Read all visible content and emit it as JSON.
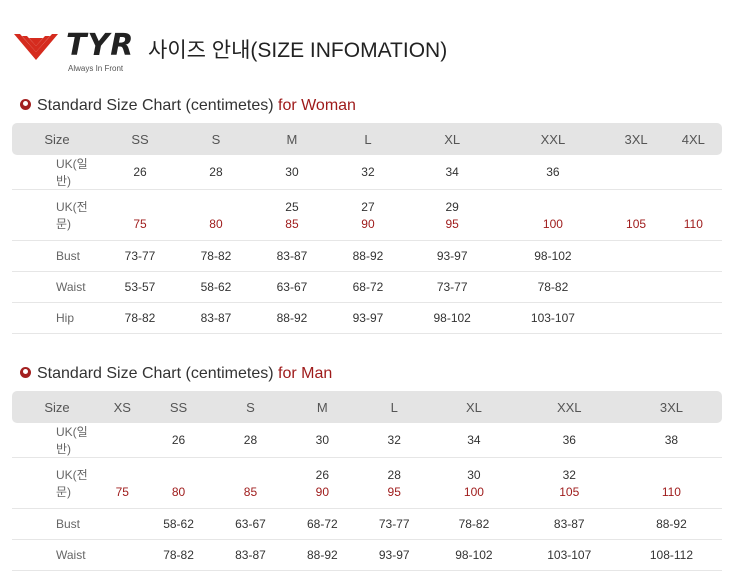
{
  "brand": {
    "name": "TYR",
    "tagline": "Always In Front",
    "accent": "#d52b1e"
  },
  "title": "사이즈 안내(SIZE INFOMATION)",
  "woman": {
    "title_prefix": "Standard Size Chart (centimetes) ",
    "title_highlight": "for Woman",
    "headers": [
      "Size",
      "SS",
      "S",
      "M",
      "L",
      "XL",
      "XXL",
      "3XL",
      "4XL"
    ],
    "uk_general": {
      "label": "UK(일반)",
      "values": [
        "26",
        "28",
        "30",
        "32",
        "34",
        "36",
        "",
        ""
      ]
    },
    "uk_pro": {
      "label": "UK(전문)",
      "top": [
        "",
        "",
        "25",
        "27",
        "29",
        "",
        "",
        ""
      ],
      "red": [
        "75",
        "80",
        "85",
        "90",
        "95",
        "100",
        "105",
        "110"
      ]
    },
    "bust": {
      "label": "Bust",
      "values": [
        "73-77",
        "78-82",
        "83-87",
        "88-92",
        "93-97",
        "98-102",
        "",
        ""
      ]
    },
    "waist": {
      "label": "Waist",
      "values": [
        "53-57",
        "58-62",
        "63-67",
        "68-72",
        "73-77",
        "78-82",
        "",
        ""
      ]
    },
    "hip": {
      "label": "Hip",
      "values": [
        "78-82",
        "83-87",
        "88-92",
        "93-97",
        "98-102",
        "103-107",
        "",
        ""
      ]
    }
  },
  "man": {
    "title_prefix": "Standard Size Chart (centimetes) ",
    "title_highlight": "for Man",
    "headers": [
      "Size",
      "XS",
      "SS",
      "S",
      "M",
      "L",
      "XL",
      "XXL",
      "3XL"
    ],
    "uk_general": {
      "label": "UK(일반)",
      "values": [
        "",
        "26",
        "28",
        "30",
        "32",
        "34",
        "36",
        "38"
      ]
    },
    "uk_pro": {
      "label": "UK(전문)",
      "top": [
        "",
        "",
        "",
        "26",
        "28",
        "30",
        "32",
        ""
      ],
      "red": [
        "75",
        "80",
        "85",
        "90",
        "95",
        "100",
        "105",
        "110"
      ]
    },
    "bust": {
      "label": "Bust",
      "values": [
        "",
        "58-62",
        "63-67",
        "68-72",
        "73-77",
        "78-82",
        "83-87",
        "88-92"
      ]
    },
    "waist": {
      "label": "Waist",
      "values": [
        "",
        "78-82",
        "83-87",
        "88-92",
        "93-97",
        "98-102",
        "103-107",
        "108-112"
      ]
    }
  }
}
